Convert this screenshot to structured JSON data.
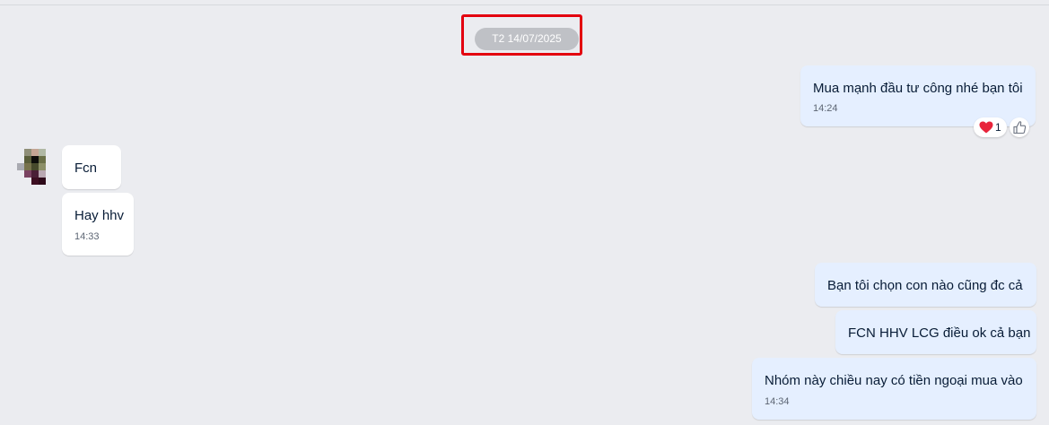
{
  "date_separator": "T2 14/07/2025",
  "messages": {
    "m1": {
      "text": "Mua mạnh đầu tư công nhé bạn tôi",
      "time": "14:24",
      "direction": "outgoing"
    },
    "m2": {
      "text": "Fcn",
      "direction": "incoming"
    },
    "m3": {
      "text": "Hay hhv",
      "time": "14:33",
      "direction": "incoming"
    },
    "m4": {
      "text": "Bạn tôi chọn con nào cũng đc cả",
      "direction": "outgoing"
    },
    "m5": {
      "text": "FCN HHV LCG điều ok cả bạn",
      "direction": "outgoing"
    },
    "m6": {
      "text": "Nhóm này chiều nay có tiền ngoại mua vào",
      "time": "14:34",
      "direction": "outgoing"
    }
  },
  "reactions": {
    "heart_count": "1",
    "heart_icon": "heart-emoji-icon",
    "like_icon": "thumbs-up-icon"
  },
  "colors": {
    "chat_background": "#ebecf0",
    "incoming_bubble": "#ffffff",
    "outgoing_bubble": "#e5efff",
    "highlight_box": "#e3000f",
    "date_pill": "#bfc1c6"
  }
}
